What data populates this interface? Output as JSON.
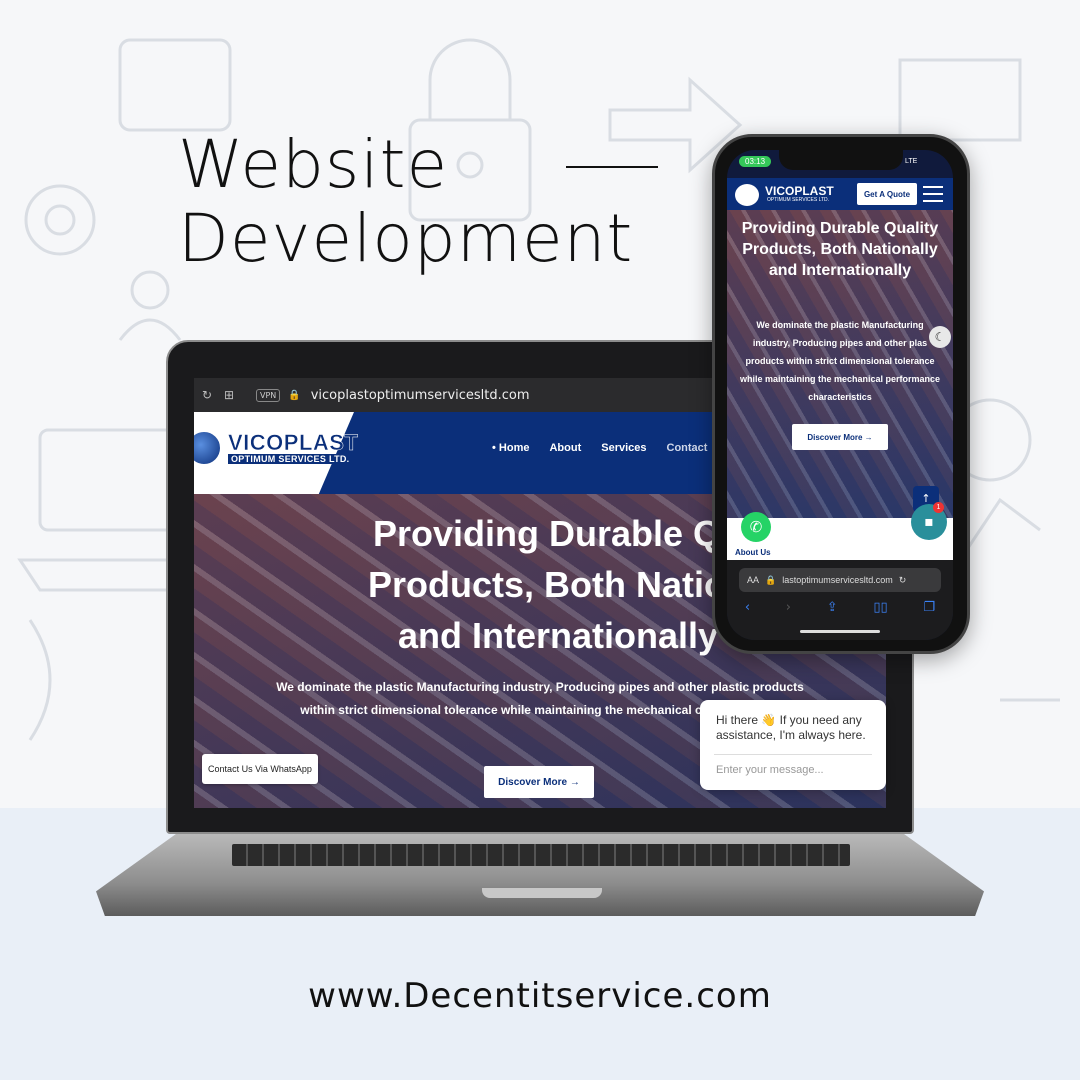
{
  "headline": {
    "line1": "Website",
    "line2": "Development"
  },
  "laptop": {
    "browser": {
      "vpn_label": "VPN",
      "url": "vicoplastoptimumservicesltd.com"
    },
    "site": {
      "logo_name": "VICOPLAST",
      "logo_sub": "OPTIMUM SERVICES LTD.",
      "nav": [
        "• Home",
        "About",
        "Services",
        "Contact"
      ],
      "hero_title": "Providing Durable Qu\nProducts, Both Nation\nand Internationally",
      "hero_desc": "We dominate the plastic Manufacturing industry, Producing pipes and other plastic products within strict dimensional tolerance while maintaining the mechanical characteristics",
      "discover_label": "Discover More →",
      "whatsapp_label": "Contact Us Via WhatsApp"
    },
    "chat": {
      "greeting": "Hi there 👋 If you need any assistance, I'm always here.",
      "placeholder": "Enter your message..."
    }
  },
  "phone": {
    "time": "03:13",
    "status": "LTE",
    "logo_name": "VICOPLAST",
    "logo_sub": "OPTIMUM SERVICES LTD.",
    "quote_label": "Get A Quote",
    "hero_title": "Providing Durable Quality Products, Both Nationally and Internationally",
    "hero_desc": "We dominate the plastic Manufacturing industry, Producing pipes and other plas products within strict dimensional tolerance while maintaining the mechanical performance characteristics",
    "discover_label": "Discover More →",
    "about_label": "About Us",
    "chat_badge": "1",
    "url": "lastoptimumservicesltd.com",
    "aa_label": "AA"
  },
  "footer": {
    "url": "www.Decentitservice.com"
  },
  "colors": {
    "brand_navy": "#0b2f7a",
    "whatsapp_green": "#25d366",
    "chat_teal": "#2a8f9b"
  }
}
